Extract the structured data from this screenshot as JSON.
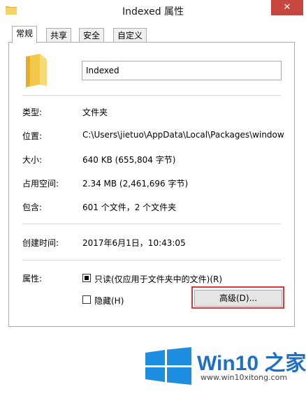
{
  "window": {
    "title": "Indexed 属性",
    "close_glyph": "✕"
  },
  "tabs": [
    {
      "label": "常规",
      "active": true
    },
    {
      "label": "共享",
      "active": false
    },
    {
      "label": "安全",
      "active": false
    },
    {
      "label": "自定义",
      "active": false
    }
  ],
  "general": {
    "name_value": "Indexed",
    "rows": [
      {
        "label": "类型:",
        "value": "文件夹"
      },
      {
        "label": "位置:",
        "value": "C:\\Users\\jietuo\\AppData\\Local\\Packages\\window"
      },
      {
        "label": "大小:",
        "value": "640 KB (655,804 字节)"
      },
      {
        "label": "占用空间:",
        "value": "2.34 MB (2,461,696 字节)"
      },
      {
        "label": "包含:",
        "value": "601 个文件，2 个文件夹"
      }
    ],
    "created": {
      "label": "创建时间:",
      "value": "2017年6月1日，10:43:05"
    },
    "attributes": {
      "label": "属性:",
      "readonly": {
        "label": "只读(仅应用于文件夹中的文件)(R)",
        "checked": true
      },
      "hidden": {
        "label": "隐藏(H)",
        "checked": false
      },
      "advanced_button": "高级(D)..."
    }
  },
  "watermark": {
    "title": "Win10 之家",
    "url": "www.win10xitong.com"
  },
  "colors": {
    "close": "#c7463e",
    "highlight": "#d9393a",
    "brand_blue": "#1f6fc9",
    "folder": "#f2c84b"
  }
}
